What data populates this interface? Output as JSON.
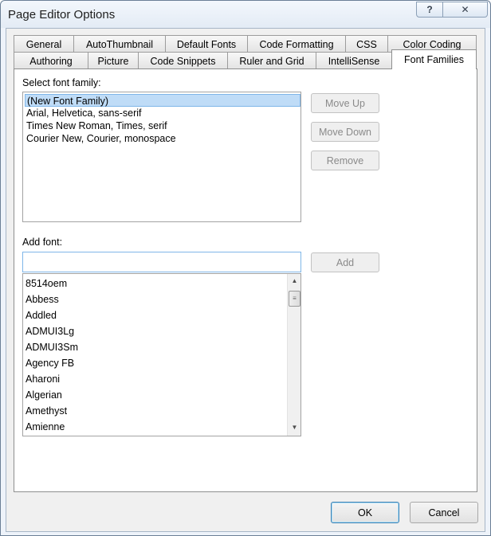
{
  "window": {
    "title": "Page Editor Options",
    "help_glyph": "?",
    "close_glyph": "✕"
  },
  "tabs": {
    "row_top": [
      "General",
      "AutoThumbnail",
      "Default Fonts",
      "Code Formatting",
      "CSS",
      "Color Coding"
    ],
    "row_bottom": [
      "Authoring",
      "Picture",
      "Code Snippets",
      "Ruler and Grid",
      "IntelliSense",
      "Font Families"
    ],
    "active": "Font Families"
  },
  "font_families": {
    "select_label": "Select font family:",
    "families": [
      "(New Font Family)",
      "Arial, Helvetica, sans-serif",
      "Times New Roman, Times, serif",
      "Courier New, Courier, monospace"
    ],
    "selected_index": 0,
    "move_up_label": "Move Up",
    "move_down_label": "Move Down",
    "remove_label": "Remove",
    "add_font_label": "Add font:",
    "add_font_value": "",
    "add_label": "Add",
    "fonts": [
      "8514oem",
      "Abbess",
      "Addled",
      "ADMUI3Lg",
      "ADMUI3Sm",
      "Agency FB",
      "Aharoni",
      "Algerian",
      "Amethyst",
      "Amienne"
    ]
  },
  "footer": {
    "ok_label": "OK",
    "cancel_label": "Cancel"
  },
  "icons": {
    "scroll_up": "▲",
    "scroll_down": "▼",
    "grip": "≡"
  }
}
